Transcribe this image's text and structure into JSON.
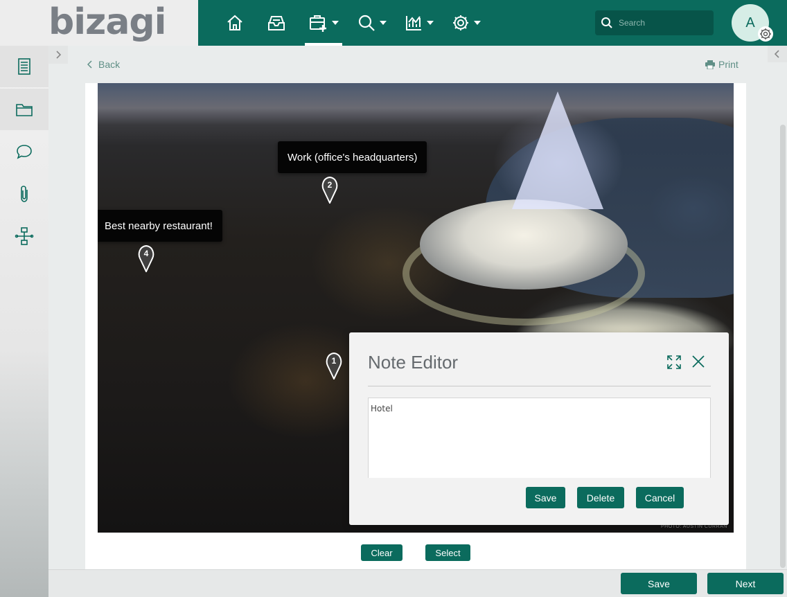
{
  "app": {
    "logo_text": "bizagi"
  },
  "topbar": {
    "nav": [
      {
        "icon": "home-icon",
        "dropdown": false,
        "active": false
      },
      {
        "icon": "inbox-icon",
        "dropdown": false,
        "active": false
      },
      {
        "icon": "new-case-icon",
        "dropdown": true,
        "active": true
      },
      {
        "icon": "search-icon",
        "dropdown": true,
        "active": false
      },
      {
        "icon": "analytics-icon",
        "dropdown": true,
        "active": false
      },
      {
        "icon": "gear-icon",
        "dropdown": true,
        "active": false
      }
    ],
    "search_placeholder": "Search",
    "avatar_initial": "A"
  },
  "sidebar": {
    "items": [
      {
        "icon": "form-icon",
        "active": true
      },
      {
        "icon": "folder-icon",
        "active": true
      },
      {
        "icon": "comment-icon",
        "active": false
      },
      {
        "icon": "attachment-icon",
        "active": false
      },
      {
        "icon": "process-map-icon",
        "active": false
      }
    ]
  },
  "content": {
    "back_label": "Back",
    "print_label": "Print",
    "photo_credit": "PHOTO: AUSTIN CURRAN",
    "markers": [
      {
        "number": "1",
        "tooltip": ""
      },
      {
        "number": "2",
        "tooltip": "Work (office's headquarters)"
      },
      {
        "number": "4",
        "tooltip": "Best nearby restaurant!"
      }
    ],
    "clear_label": "Clear",
    "select_label": "Select"
  },
  "note_editor": {
    "title": "Note Editor",
    "text_value": "Hotel",
    "save_label": "Save",
    "delete_label": "Delete",
    "cancel_label": "Cancel"
  },
  "footer": {
    "save_label": "Save",
    "next_label": "Next"
  },
  "colors": {
    "primary": "#0b6b5d",
    "primary_dark": "#075449",
    "link": "#5f8f86",
    "tooltip_bg": "#050505"
  }
}
